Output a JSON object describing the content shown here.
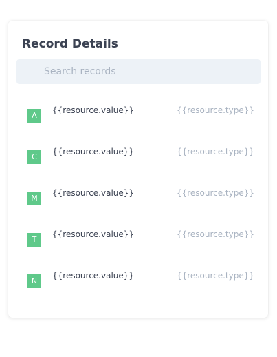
{
  "panel": {
    "title": "Record Details",
    "search_placeholder": "Search records"
  },
  "records": [
    {
      "letter": "A",
      "value": "{{resource.value}}",
      "type": "{{resource.type}}"
    },
    {
      "letter": "C",
      "value": "{{resource.value}}",
      "type": "{{resource.type}}"
    },
    {
      "letter": "M",
      "value": "{{resource.value}}",
      "type": "{{resource.type}}"
    },
    {
      "letter": "T",
      "value": "{{resource.value}}",
      "type": "{{resource.type}}"
    },
    {
      "letter": "N",
      "value": "{{resource.value}}",
      "type": "{{resource.type}}"
    }
  ],
  "colors": {
    "badge": "#5fc98a",
    "title_text": "#3b4252",
    "muted_text": "#a9b3c1",
    "search_bg": "#edf2f7"
  }
}
